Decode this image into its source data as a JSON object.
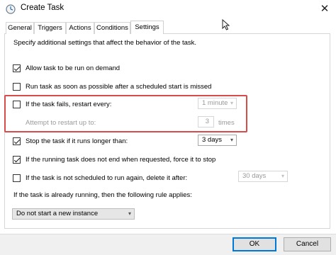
{
  "window": {
    "title": "Create Task",
    "app_icon": "clock-icon",
    "close_icon": "close-icon",
    "close_glyph": "✕"
  },
  "tabs": [
    {
      "label": "General",
      "active": false
    },
    {
      "label": "Triggers",
      "active": false
    },
    {
      "label": "Actions",
      "active": false
    },
    {
      "label": "Conditions",
      "active": false
    },
    {
      "label": "Settings",
      "active": true
    }
  ],
  "settings": {
    "intro": "Specify additional settings that affect the behavior of the task.",
    "allow_on_demand": {
      "label": "Allow task to be run on demand",
      "checked": true
    },
    "run_missed": {
      "label": "Run task as soon as possible after a scheduled start is missed",
      "checked": false
    },
    "restart_on_fail": {
      "label": "If the task fails, restart every:",
      "checked": false,
      "interval": "1 minute"
    },
    "restart_attempts": {
      "label": "Attempt to restart up to:",
      "value": "3",
      "unit": "times"
    },
    "stop_if_longer": {
      "label": "Stop the task if it runs longer than:",
      "checked": true,
      "duration": "3 days"
    },
    "force_stop": {
      "label": "If the running task does not end when requested, force it to stop",
      "checked": true
    },
    "delete_if_unscheduled": {
      "label": "If the task is not scheduled to run again, delete it after:",
      "checked": false,
      "duration": "30 days"
    },
    "rule_label": "If the task is already running, then the following rule applies:",
    "rule_value": "Do not start a new instance"
  },
  "buttons": {
    "ok": "OK",
    "cancel": "Cancel"
  },
  "colors": {
    "highlight": "#d94a4a",
    "default_button_border": "#0078d7"
  }
}
